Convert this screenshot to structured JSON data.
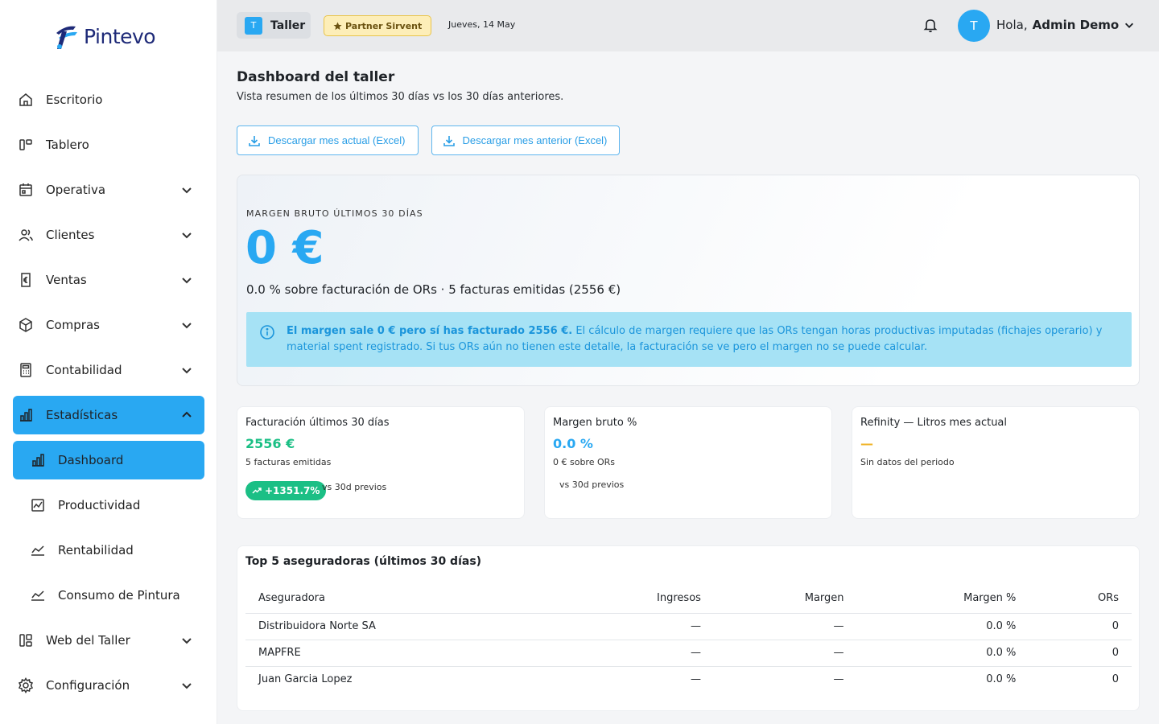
{
  "brand": {
    "name": "Pintevo"
  },
  "colors": {
    "accent": "#29a8f2",
    "success": "#1bbf85",
    "warning": "#f0b429",
    "partner_bg": "#fdeeb8"
  },
  "sidebar": {
    "items": [
      {
        "label": "Escritorio",
        "icon": "home-icon"
      },
      {
        "label": "Tablero",
        "icon": "board-icon"
      },
      {
        "label": "Operativa",
        "icon": "calendar-icon"
      },
      {
        "label": "Clientes",
        "icon": "users-icon"
      },
      {
        "label": "Ventas",
        "icon": "euro-doc-icon"
      },
      {
        "label": "Compras",
        "icon": "box-icon"
      },
      {
        "label": "Contabilidad",
        "icon": "calculator-icon"
      },
      {
        "label": "Estadísticas",
        "icon": "bar-chart-icon"
      },
      {
        "label": "Web del Taller",
        "icon": "layout-icon"
      },
      {
        "label": "Configuración",
        "icon": "gear-icon"
      }
    ],
    "subitems": [
      {
        "label": "Dashboard",
        "icon": "bar-chart-icon"
      },
      {
        "label": "Productividad",
        "icon": "line-chart-icon"
      },
      {
        "label": "Rentabilidad",
        "icon": "trend-icon"
      },
      {
        "label": "Consumo de Pintura",
        "icon": "trend-icon"
      }
    ]
  },
  "header": {
    "workspace_initial": "T",
    "workspace_name": "Taller",
    "partner_label": "Partner Sirvent",
    "date": "Jueves, 14 May",
    "avatar_initial": "T",
    "greeting": "Hola,",
    "user_name": "Admin Demo"
  },
  "page": {
    "title": "Dashboard del taller",
    "subtitle": "Vista resumen de los últimos 30 días vs los 30 días anteriores.",
    "download_current": "Descargar mes actual (Excel)",
    "download_previous": "Descargar mes anterior (Excel)"
  },
  "hero": {
    "kicker": "MARGEN BRUTO ÚLTIMOS 30 DÍAS",
    "value": "0 €",
    "description": "0.0 % sobre facturación de ORs · 5 facturas emitidas (2556 €)",
    "alert_bold": "El margen sale 0 € pero sí has facturado 2556 €.",
    "alert_text": "El cálculo de margen requiere que las ORs tengan horas productivas imputadas (fichajes operario) y material spent registrado. Si tus ORs aún no tienen este detalle, la facturación se ve pero el margen no se puede calcular."
  },
  "stats": [
    {
      "title": "Facturación últimos 30 días",
      "value": "2556 €",
      "sub": "5 facturas emitidas",
      "trend": "+1351.7%",
      "vs": "vs 30d previos"
    },
    {
      "title": "Margen bruto %",
      "value": "0.0 %",
      "sub": "0 € sobre ORs",
      "vs": "vs 30d previos"
    },
    {
      "title": "Refinity — Litros mes actual",
      "value": "—",
      "sub": "Sin datos del periodo"
    }
  ],
  "insurers": {
    "title": "Top 5 aseguradoras (últimos 30 días)",
    "columns": [
      "Aseguradora",
      "Ingresos",
      "Margen",
      "Margen %",
      "ORs"
    ],
    "rows": [
      [
        "Distribuidora Norte SA",
        "—",
        "—",
        "0.0 %",
        "0"
      ],
      [
        "MAPFRE",
        "—",
        "—",
        "0.0 %",
        "0"
      ],
      [
        "Juan Garcia Lopez",
        "—",
        "—",
        "0.0 %",
        "0"
      ]
    ]
  }
}
